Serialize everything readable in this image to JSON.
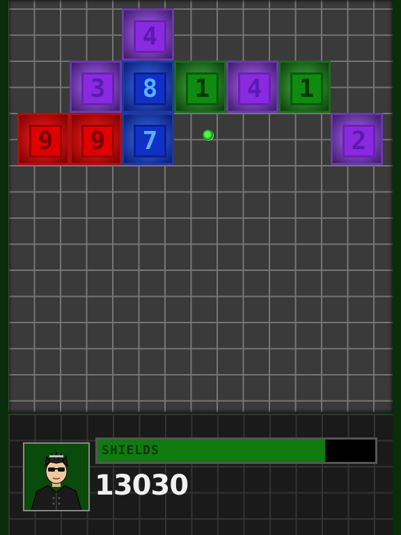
{
  "blocks": [
    {
      "number": "4",
      "color": "purple"
    },
    {
      "number": "3",
      "color": "purple"
    },
    {
      "number": "8",
      "color": "blue"
    },
    {
      "number": "1",
      "color": "green"
    },
    {
      "number": "4",
      "color": "purple"
    },
    {
      "number": "1",
      "color": "green"
    },
    {
      "number": "9",
      "color": "red"
    },
    {
      "number": "9",
      "color": "red"
    },
    {
      "number": "7",
      "color": "blue"
    },
    {
      "number": "2",
      "color": "purple"
    }
  ],
  "hud": {
    "shield_label": "SHIELDS",
    "shield_level": 0.82,
    "score": "13030"
  },
  "colors": {
    "red": "#e00000",
    "blue": "#1030c8",
    "green": "#108a10",
    "purple": "#8a2ae0",
    "shield": "#117a11"
  }
}
